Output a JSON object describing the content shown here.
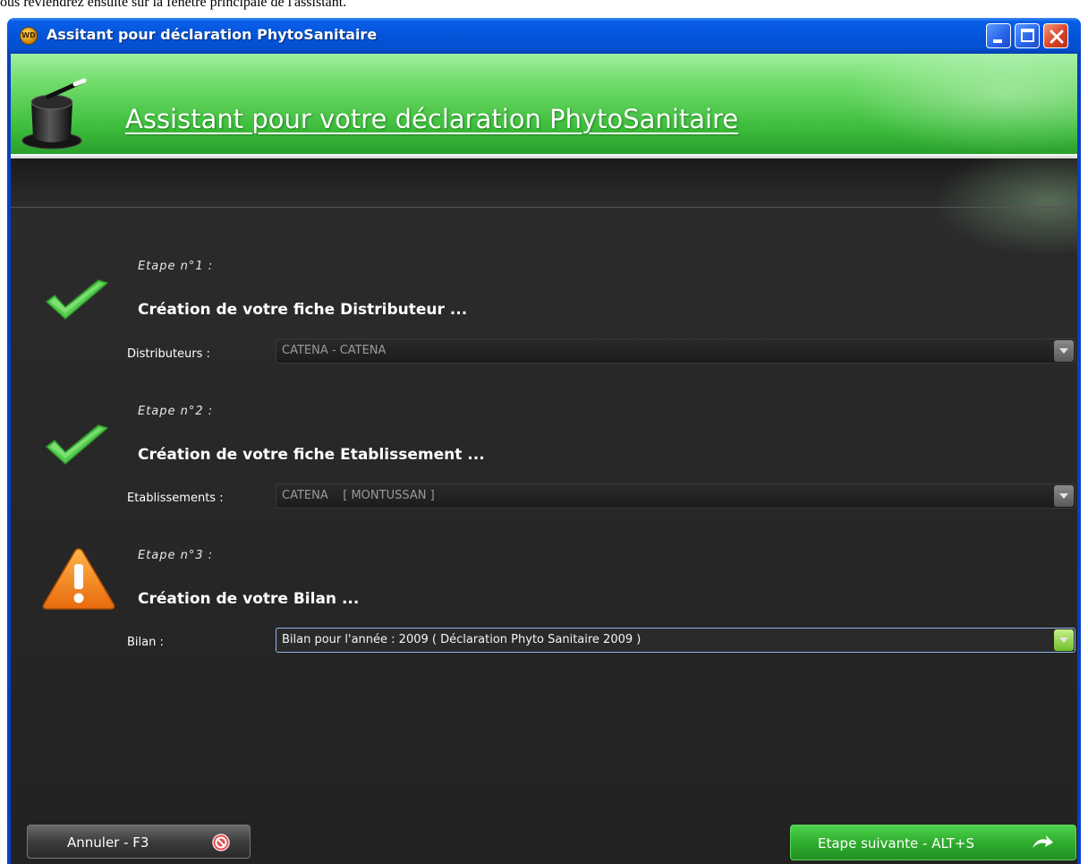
{
  "caption": "ous reviendrez ensuite sur la fenêtre principale de l'assistant.",
  "window": {
    "title": "Assitant pour déclaration PhytoSanitaire",
    "icon_text": "WD"
  },
  "header": {
    "title": "Assistant pour votre déclaration PhytoSanitaire"
  },
  "steps": [
    {
      "label": "Etape n°1 :",
      "title": "Création de votre fiche Distributeur ...",
      "status": "done",
      "field_label": "Distributeurs :",
      "field_value": "CATENA - CATENA"
    },
    {
      "label": "Etape n°2 :",
      "title": "Création de votre fiche Etablissement ...",
      "status": "done",
      "field_label": "Etablissements :",
      "field_value": "CATENA    [ MONTUSSAN ]"
    },
    {
      "label": "Etape n°3 :",
      "title": "Création de votre Bilan ...",
      "status": "warning",
      "field_label": "Bilan :",
      "field_value": "Bilan pour l'année : 2009 ( Déclaration Phyto Sanitaire 2009 )"
    }
  ],
  "buttons": {
    "cancel": "Annuler - F3",
    "next": "Etape suivante - ALT+S"
  },
  "colors": {
    "accent_green": "#3cbc3a",
    "background": "#2a2a2a",
    "title_bar": "#0454d9",
    "warning": "#f28a1c"
  }
}
